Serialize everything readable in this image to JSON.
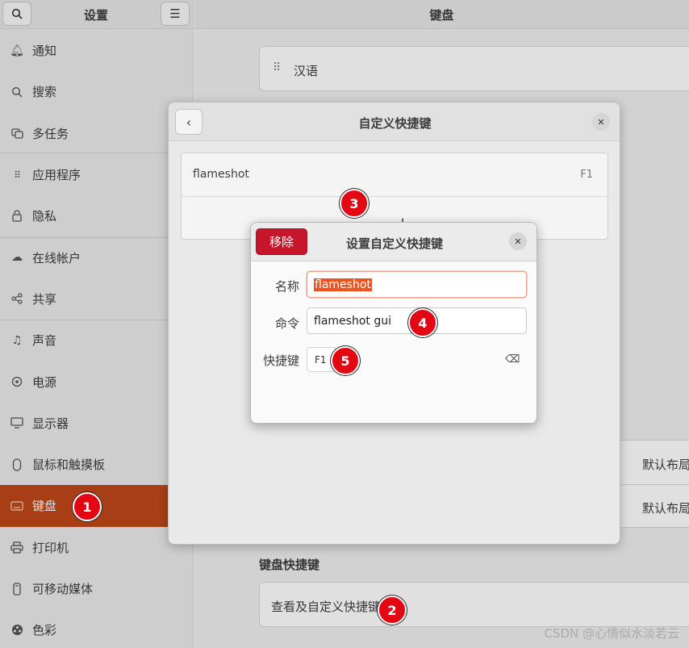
{
  "sidebar": {
    "title": "设置",
    "items": [
      {
        "label": "通知",
        "icon": "bell-icon"
      },
      {
        "label": "搜索",
        "icon": "search-icon"
      },
      {
        "label": "多任务",
        "icon": "multitask-icon"
      },
      {
        "label": "应用程序",
        "icon": "apps-grid-icon"
      },
      {
        "label": "隐私",
        "icon": "lock-icon"
      },
      {
        "label": "在线帐户",
        "icon": "cloud-icon"
      },
      {
        "label": "共享",
        "icon": "share-icon"
      },
      {
        "label": "声音",
        "icon": "music-note-icon"
      },
      {
        "label": "电源",
        "icon": "power-icon"
      },
      {
        "label": "显示器",
        "icon": "display-icon"
      },
      {
        "label": "鼠标和触摸板",
        "icon": "mouse-icon"
      },
      {
        "label": "键盘",
        "icon": "keyboard-icon"
      },
      {
        "label": "打印机",
        "icon": "printer-icon"
      },
      {
        "label": "可移动媒体",
        "icon": "removable-media-icon"
      },
      {
        "label": "色彩",
        "icon": "color-icon"
      }
    ]
  },
  "main": {
    "title": "键盘",
    "input_source": "汉语",
    "layout_value_1": "默认布局",
    "layout_value_2": "默认布局",
    "shortcuts_section_title": "键盘快捷键",
    "view_shortcuts_label": "查看及自定义快捷键"
  },
  "custom_dialog": {
    "title": "自定义快捷键",
    "shortcut_name": "flameshot",
    "shortcut_key": "F1",
    "add_label": "+"
  },
  "edit_dialog": {
    "remove_label": "移除",
    "title": "设置自定义快捷键",
    "name_label": "名称",
    "name_value": "flameshot",
    "command_label": "命令",
    "command_value": "flameshot gui",
    "shortcut_label": "快捷键",
    "shortcut_value": "F1"
  },
  "badges": [
    "1",
    "2",
    "3",
    "4",
    "5"
  ],
  "watermark": "CSDN @心情似水淡若云",
  "colors": {
    "accent": "#c04718",
    "danger": "#c7162b",
    "selection": "#e95420",
    "badge": "#e30613"
  }
}
